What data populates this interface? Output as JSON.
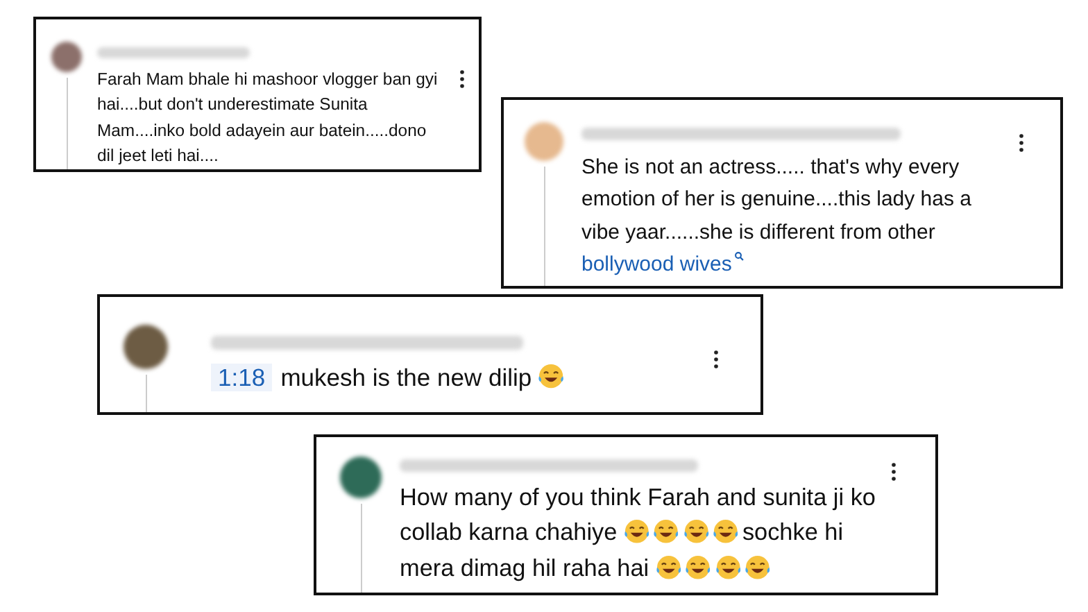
{
  "comments": [
    {
      "color": "#8c706b",
      "lines": [
        [
          {
            "kind": "text",
            "text": "Farah Mam bhale hi mashoor vlogger ban gyi"
          }
        ],
        [
          {
            "kind": "text",
            "text": "hai....but don't underestimate Sunita"
          }
        ],
        [
          {
            "kind": "text",
            "text": "Mam....inko bold adayein aur batein.....dono"
          }
        ],
        [
          {
            "kind": "text",
            "text": "dil jeet leti hai...."
          }
        ]
      ]
    },
    {
      "color": "#e6b98f",
      "lines": [
        [
          {
            "kind": "text",
            "text": "She is not an actress..... that's why every"
          }
        ],
        [
          {
            "kind": "text",
            "text": "emotion of her is genuine....this lady has a"
          }
        ],
        [
          {
            "kind": "text",
            "text": "vibe yaar......she is different from other"
          }
        ],
        [
          {
            "kind": "link",
            "text": "bollywood wives"
          }
        ]
      ]
    },
    {
      "color": "#6d5c44",
      "lines": [
        [
          {
            "kind": "timestamp",
            "text": "1:18"
          },
          {
            "kind": "text",
            "text": "mukesh is the new dilip"
          },
          {
            "kind": "emoji"
          }
        ]
      ]
    },
    {
      "color": "#2e6b58",
      "lines": [
        [
          {
            "kind": "text",
            "text": "How many of you think Farah and sunita ji ko"
          }
        ],
        [
          {
            "kind": "text",
            "text": "collab karna chahiye"
          },
          {
            "kind": "emoji"
          },
          {
            "kind": "emoji"
          },
          {
            "kind": "emoji"
          },
          {
            "kind": "emoji"
          },
          {
            "kind": "text",
            "text": "sochke hi"
          }
        ],
        [
          {
            "kind": "text",
            "text": "mera dimag hil raha hai"
          },
          {
            "kind": "emoji"
          },
          {
            "kind": "emoji"
          },
          {
            "kind": "emoji"
          },
          {
            "kind": "emoji"
          }
        ]
      ]
    }
  ]
}
